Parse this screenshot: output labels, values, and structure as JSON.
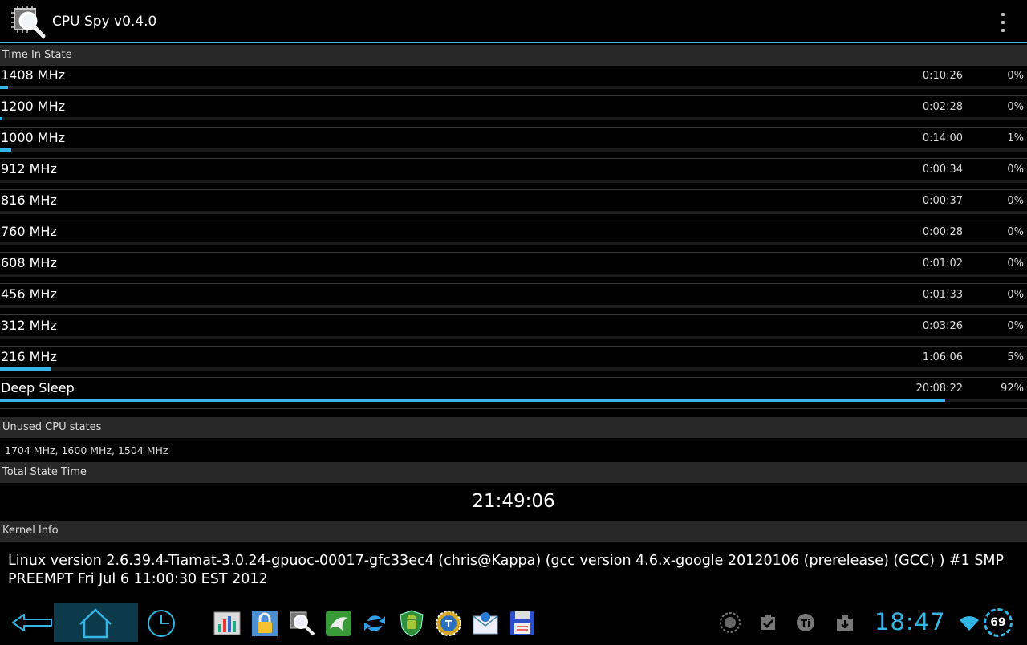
{
  "app": {
    "title": "CPU Spy v0.4.0"
  },
  "sections": {
    "time_in_state": "Time In State",
    "unused_cpu_states": "Unused CPU states",
    "total_state_time": "Total State Time",
    "kernel_info": "Kernel Info"
  },
  "states": [
    {
      "freq": "1408 MHz",
      "time": "0:10:26",
      "percent": "0%",
      "fraction": 0.008
    },
    {
      "freq": "1200 MHz",
      "time": "0:02:28",
      "percent": "0%",
      "fraction": 0.002
    },
    {
      "freq": "1000 MHz",
      "time": "0:14:00",
      "percent": "1%",
      "fraction": 0.011
    },
    {
      "freq": "912 MHz",
      "time": "0:00:34",
      "percent": "0%",
      "fraction": 0.0
    },
    {
      "freq": "816 MHz",
      "time": "0:00:37",
      "percent": "0%",
      "fraction": 0.0
    },
    {
      "freq": "760 MHz",
      "time": "0:00:28",
      "percent": "0%",
      "fraction": 0.0
    },
    {
      "freq": "608 MHz",
      "time": "0:01:02",
      "percent": "0%",
      "fraction": 0.0
    },
    {
      "freq": "456 MHz",
      "time": "0:01:33",
      "percent": "0%",
      "fraction": 0.0
    },
    {
      "freq": "312 MHz",
      "time": "0:03:26",
      "percent": "0%",
      "fraction": 0.0
    },
    {
      "freq": "216 MHz",
      "time": "1:06:06",
      "percent": "5%",
      "fraction": 0.05
    },
    {
      "freq": "Deep Sleep",
      "time": "20:08:22",
      "percent": "92%",
      "fraction": 0.92
    }
  ],
  "unused_states": "1704 MHz, 1600 MHz, 1504 MHz",
  "total_time": "21:49:06",
  "kernel": "Linux version 2.6.39.4-Tiamat-3.0.24-gpuoc-00017-gfc33ec4 (chris@Kappa) (gcc version 4.6.x-google 20120106 (prerelease) (GCC) ) #1 SMP PREEMPT Fri Jul 6 11:00:30 EST 2012",
  "statusbar": {
    "clock": "18:47",
    "battery": "69"
  },
  "colors": {
    "accent": "#33b5e5",
    "header_bg": "#282828"
  },
  "icons": {
    "dock": [
      "chart-app-icon",
      "lock-app-icon",
      "cpu-spy-icon",
      "dolphin-browser-icon",
      "sync-icon",
      "android-shield-icon",
      "titanium-backup-icon",
      "mail-icon",
      "save-disk-icon"
    ],
    "status": [
      "app-notification-icon",
      "checkbox-notification-icon",
      "titanium-notification-icon",
      "download-notification-icon",
      "wifi-icon"
    ]
  }
}
